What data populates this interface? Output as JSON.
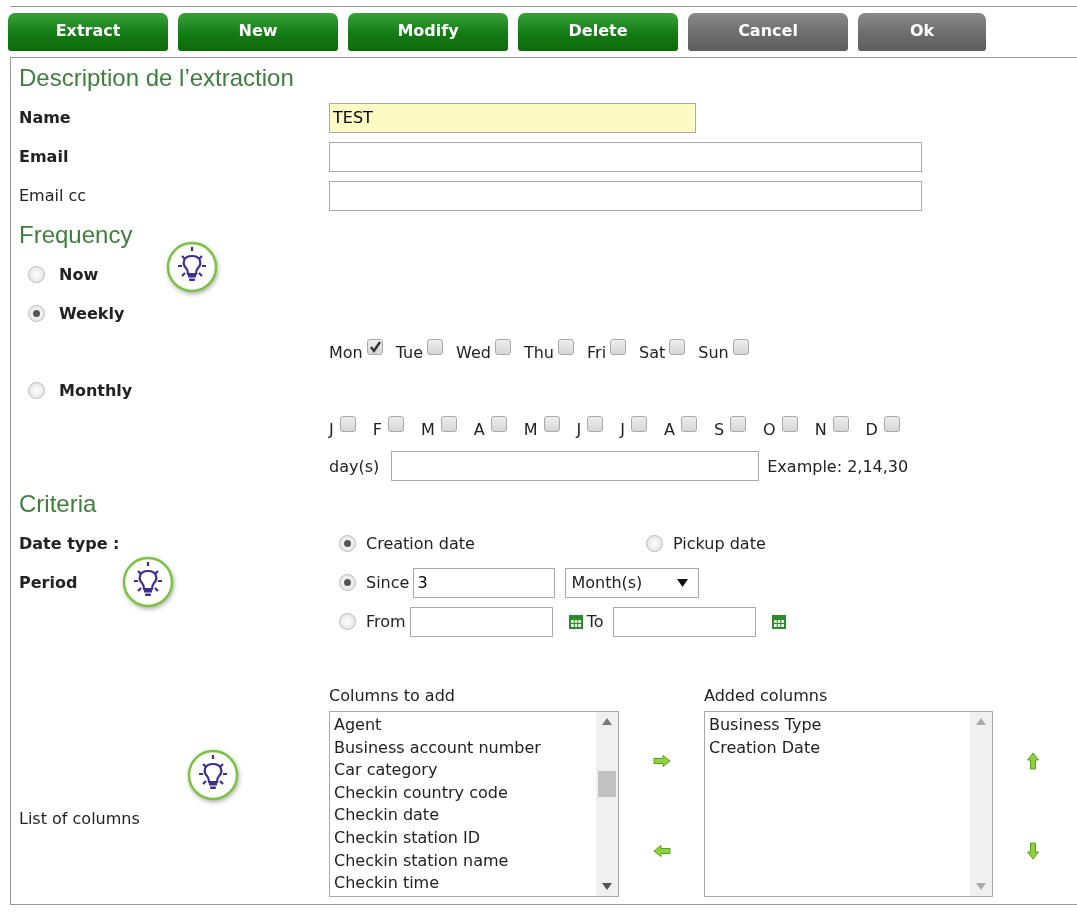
{
  "toolbar": [
    {
      "label": "Extract",
      "kind": "primary"
    },
    {
      "label": "New",
      "kind": "primary"
    },
    {
      "label": "Modify",
      "kind": "primary"
    },
    {
      "label": "Delete",
      "kind": "primary"
    },
    {
      "label": "Cancel",
      "kind": "secondary"
    },
    {
      "label": "Ok",
      "kind": "secondary"
    }
  ],
  "description": {
    "title": "Description de l’extraction",
    "fields": [
      {
        "label": "Name",
        "bold": true,
        "value": "TEST",
        "highlighted": true
      },
      {
        "label": "Email",
        "bold": true,
        "highlighted": false
      },
      {
        "label": "Email cc",
        "bold": false,
        "highlighted": false
      }
    ]
  },
  "frequency": {
    "title": "Frequency",
    "options": [
      {
        "label": "Now",
        "selected": false
      },
      {
        "label": "Weekly",
        "selected": true
      },
      {
        "label": "Monthly",
        "selected": false
      }
    ],
    "weekdays": [
      {
        "label": "Mon",
        "checked": true
      },
      {
        "label": "Tue",
        "checked": false
      },
      {
        "label": "Wed",
        "checked": false
      },
      {
        "label": "Thu",
        "checked": false
      },
      {
        "label": "Fri",
        "checked": false
      },
      {
        "label": "Sat",
        "checked": false
      },
      {
        "label": "Sun",
        "checked": false
      }
    ],
    "months": [
      {
        "label": "J",
        "checked": false
      },
      {
        "label": "F",
        "checked": false
      },
      {
        "label": "M",
        "checked": false
      },
      {
        "label": "A",
        "checked": false
      },
      {
        "label": "M",
        "checked": false
      },
      {
        "label": "J",
        "checked": false
      },
      {
        "label": "J",
        "checked": false
      },
      {
        "label": "A",
        "checked": false
      },
      {
        "label": "S",
        "checked": false
      },
      {
        "label": "O",
        "checked": false
      },
      {
        "label": "N",
        "checked": false
      },
      {
        "label": "D",
        "checked": false
      }
    ],
    "days": {
      "label": "day(s)",
      "hint": "Example: 2,14,30"
    }
  },
  "criteria": {
    "title": "Criteria",
    "date_type": {
      "label": "Date type :",
      "options": [
        {
          "label": "Creation date",
          "selected": true
        },
        {
          "label": "Pickup date",
          "selected": false
        }
      ]
    },
    "period": {
      "label": "Period",
      "since": {
        "label": "Since",
        "selected": true,
        "value": "3",
        "unit": "Month(s)"
      },
      "from": {
        "label": "From",
        "selected": false,
        "to_label": "To"
      }
    },
    "columns": {
      "label": "List of columns",
      "available": {
        "title": "Columns to add",
        "items": [
          "Agent",
          "Business account number",
          "Car category",
          "Checkin country code",
          "Checkin date",
          "Checkin station ID",
          "Checkin station name",
          "Checkin time"
        ]
      },
      "added": {
        "title": "Added columns",
        "items": [
          "Business Type",
          "Creation Date"
        ]
      }
    }
  }
}
